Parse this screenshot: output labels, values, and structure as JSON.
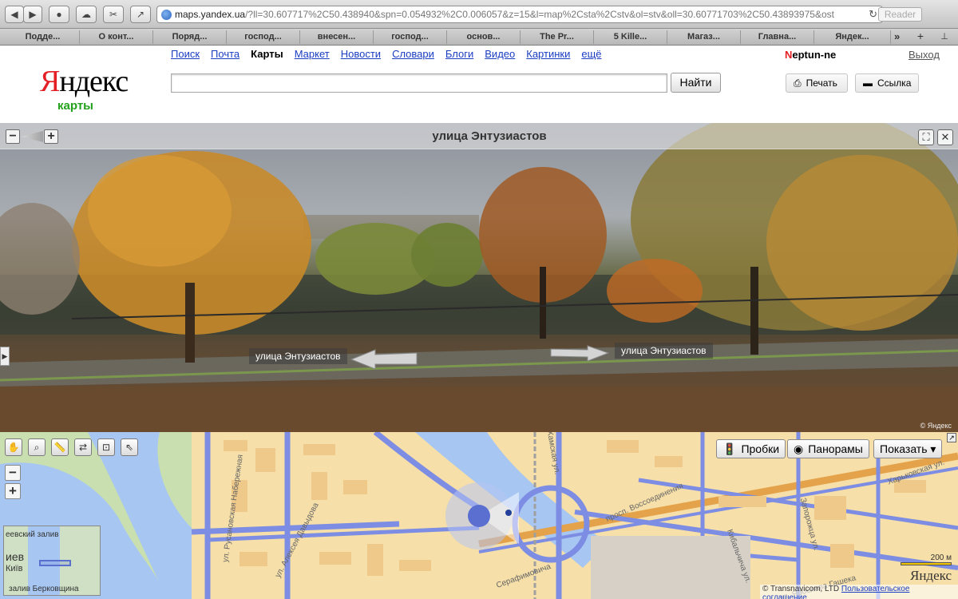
{
  "browser": {
    "url_main": "maps.yandex.ua",
    "url_rest": "/?ll=30.607717%2C50.438940&spn=0.054932%2C0.006057&z=15&l=map%2Csta%2Cstv&ol=stv&oll=30.60771703%2C50.43893975&ost",
    "reader_label": "Reader",
    "bookmarks": [
      "Подде...",
      "О конт...",
      "Поряд...",
      "господ...",
      "внесен...",
      "господ...",
      "основ...",
      "The Pr...",
      "5 Kille...",
      "Магаз...",
      "Главна...",
      "Яндек..."
    ]
  },
  "header": {
    "logo_first": "Я",
    "logo_rest": "ндекс",
    "logo_sub": "карты",
    "nav": [
      "Поиск",
      "Почта",
      "Карты",
      "Маркет",
      "Новости",
      "Словари",
      "Блоги",
      "Видео",
      "Картинки",
      "ещё"
    ],
    "search_button": "Найти",
    "user_first": "N",
    "user_rest": "eptun-ne",
    "logout": "Выход",
    "print_label": "Печать",
    "link_label": "Ссылка"
  },
  "panorama": {
    "title": "улица Энтузиастов",
    "label_left": "улица Энтузиастов",
    "label_right": "улица Энтузиастов",
    "copyright": "© Яндекс"
  },
  "map": {
    "traffic_label": "Пробки",
    "panoramas_label": "Панорамы",
    "show_label": "Показать ▾",
    "scale_label": "200 м",
    "logo": "Яндекс",
    "copyright": "© Transnavicom, LTD",
    "agreement": "Пользовательское соглашение",
    "minimap": {
      "city_ru": "иев",
      "city_ua": "Київ",
      "bay_top": "еевский залив",
      "bay_bottom": "залив Берковщина"
    },
    "street_labels": [
      "ул. Русановская Набережная",
      "ул. Алексея Давыдова",
      "просп. Воссоединения",
      "ул. Ярослава Гашека",
      "Харьковская ул.",
      "Кибальчича ул.",
      "Запорожца ул.",
      "Серафимовича",
      "Хамская ул."
    ]
  }
}
